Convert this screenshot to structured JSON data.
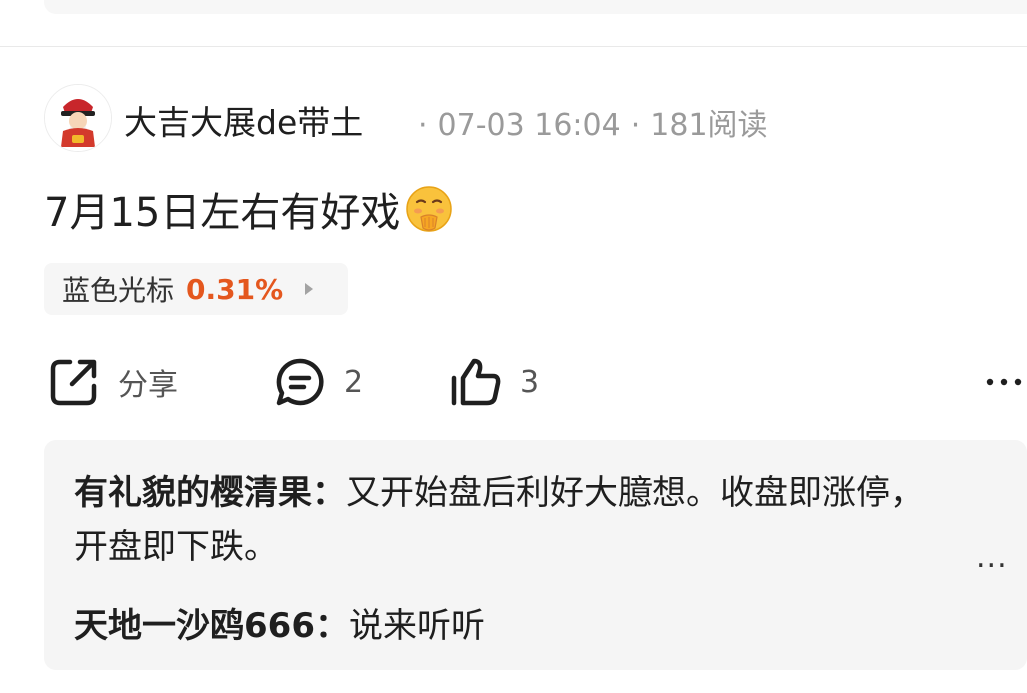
{
  "post": {
    "author": "大吉大展de带土",
    "time": "07-03 16:04",
    "reads": "181阅读",
    "text": "7月15日左右有好戏",
    "emoji": "shushing-face-emoji"
  },
  "stock_tag": {
    "name": "蓝色光标",
    "change": "0.31%",
    "change_color": "#e4571e"
  },
  "actions": {
    "share_label": "分享",
    "comment_count": "2",
    "like_count": "3"
  },
  "comments": [
    {
      "user": "有礼貌的樱清果：",
      "text": "又开始盘后利好大臆想。收盘即涨停，开盘即下跌。"
    },
    {
      "user": "天地一沙鸥666：",
      "text": "说来听听"
    }
  ],
  "comments_more": "..."
}
